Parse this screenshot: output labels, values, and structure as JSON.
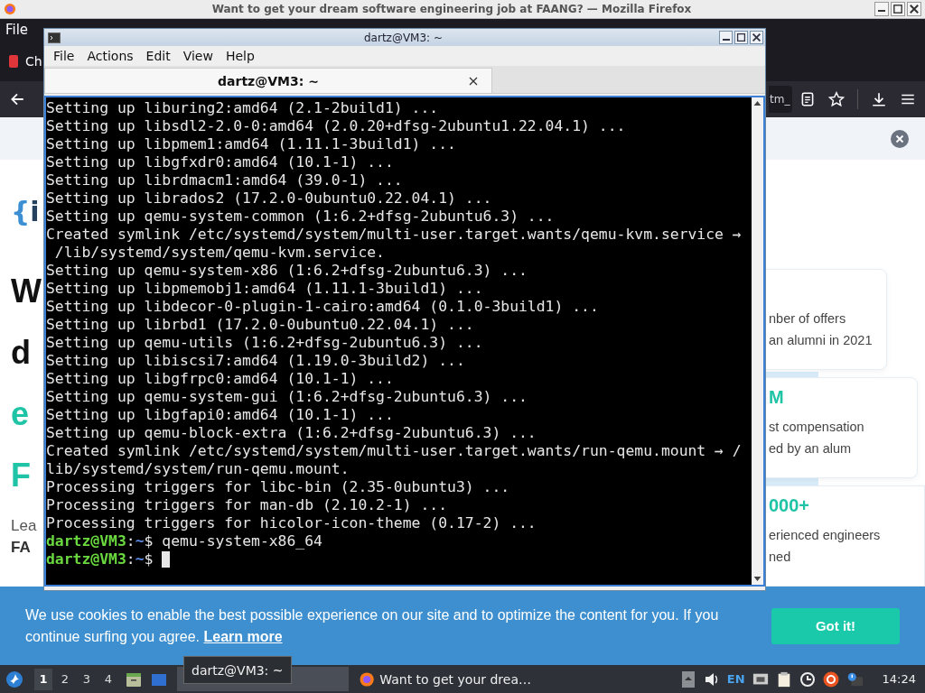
{
  "firefox": {
    "title": "Want to get your dream software engineering job at FAANG? — Mozilla Firefox",
    "menu": [
      "File"
    ],
    "tab": {
      "label": "Ch"
    },
    "url_fragment": "tm_",
    "page": {
      "logo": {
        "brace": "{",
        "text": "i"
      },
      "headline": [
        {
          "text": "W",
          "accent": false
        },
        {
          "text": "d",
          "accent": false
        },
        {
          "text": "e",
          "accent": true
        },
        {
          "text": "F",
          "accent": true
        }
      ],
      "lead": "Lea",
      "lead_bold": "FA",
      "cards": [
        {
          "lines": [
            "nber of offers",
            "an alumni in 2021"
          ]
        },
        {
          "figure": "M",
          "lines": [
            "st compensation",
            "ed by an alum"
          ]
        },
        {
          "figure": "000+",
          "lines": [
            "erienced engineers",
            "ned"
          ]
        }
      ]
    },
    "cookie": {
      "text": "We use cookies to enable the best possible experience on our site and to optimize the content for you. If you continue surfing you agree.",
      "link": "Learn more",
      "button": "Got it!"
    }
  },
  "terminal": {
    "title": "dartz@VM3: ~",
    "menu": [
      "File",
      "Actions",
      "Edit",
      "View",
      "Help"
    ],
    "tab": "dartz@VM3: ~",
    "lines": [
      {
        "kind": "output",
        "text": "Setting up liburing2:amd64 (2.1-2build1) ..."
      },
      {
        "kind": "output",
        "text": "Setting up libsdl2-2.0-0:amd64 (2.0.20+dfsg-2ubuntu1.22.04.1) ..."
      },
      {
        "kind": "output",
        "text": "Setting up libpmem1:amd64 (1.11.1-3build1) ..."
      },
      {
        "kind": "output",
        "text": "Setting up libgfxdr0:amd64 (10.1-1) ..."
      },
      {
        "kind": "output",
        "text": "Setting up librdmacm1:amd64 (39.0-1) ..."
      },
      {
        "kind": "output",
        "text": "Setting up librados2 (17.2.0-0ubuntu0.22.04.1) ..."
      },
      {
        "kind": "output",
        "text": "Setting up qemu-system-common (1:6.2+dfsg-2ubuntu6.3) ..."
      },
      {
        "kind": "output",
        "text": "Created symlink /etc/systemd/system/multi-user.target.wants/qemu-kvm.service →"
      },
      {
        "kind": "output",
        "text": " /lib/systemd/system/qemu-kvm.service."
      },
      {
        "kind": "output",
        "text": "Setting up qemu-system-x86 (1:6.2+dfsg-2ubuntu6.3) ..."
      },
      {
        "kind": "output",
        "text": "Setting up libpmemobj1:amd64 (1.11.1-3build1) ..."
      },
      {
        "kind": "output",
        "text": "Setting up libdecor-0-plugin-1-cairo:amd64 (0.1.0-3build1) ..."
      },
      {
        "kind": "output",
        "text": "Setting up librbd1 (17.2.0-0ubuntu0.22.04.1) ..."
      },
      {
        "kind": "output",
        "text": "Setting up qemu-utils (1:6.2+dfsg-2ubuntu6.3) ..."
      },
      {
        "kind": "output",
        "text": "Setting up libiscsi7:amd64 (1.19.0-3build2) ..."
      },
      {
        "kind": "output",
        "text": "Setting up libgfrpc0:amd64 (10.1-1) ..."
      },
      {
        "kind": "output",
        "text": "Setting up qemu-system-gui (1:6.2+dfsg-2ubuntu6.3) ..."
      },
      {
        "kind": "output",
        "text": "Setting up libgfapi0:amd64 (10.1-1) ..."
      },
      {
        "kind": "output",
        "text": "Setting up qemu-block-extra (1:6.2+dfsg-2ubuntu6.3) ..."
      },
      {
        "kind": "output",
        "text": "Created symlink /etc/systemd/system/multi-user.target.wants/run-qemu.mount → /"
      },
      {
        "kind": "output",
        "text": "lib/systemd/system/run-qemu.mount."
      },
      {
        "kind": "output",
        "text": "Processing triggers for libc-bin (2.35-0ubuntu3) ..."
      },
      {
        "kind": "output",
        "text": "Processing triggers for man-db (2.10.2-1) ..."
      },
      {
        "kind": "output",
        "text": "Processing triggers for hicolor-icon-theme (0.17-2) ..."
      },
      {
        "kind": "prompt",
        "user": "dartz@VM3",
        "sep": ":",
        "path": "~",
        "symbol": "$",
        "command": "qemu-system-x86_64",
        "cursor": false
      },
      {
        "kind": "prompt",
        "user": "dartz@VM3",
        "sep": ":",
        "path": "~",
        "symbol": "$",
        "cursor": true
      }
    ]
  },
  "taskbar": {
    "workspaces": [
      {
        "label": "1",
        "selected": true
      },
      {
        "label": "2",
        "selected": false
      },
      {
        "label": "3",
        "selected": false
      },
      {
        "label": "4",
        "selected": false
      }
    ],
    "tasks": [
      {
        "selected": true,
        "kind": "terminal"
      },
      {
        "label": "Want to get your drea…",
        "selected": false,
        "kind": "browser"
      }
    ],
    "tooltip": "dartz@VM3: ~",
    "keyboard": "EN",
    "clock": "14:24"
  }
}
